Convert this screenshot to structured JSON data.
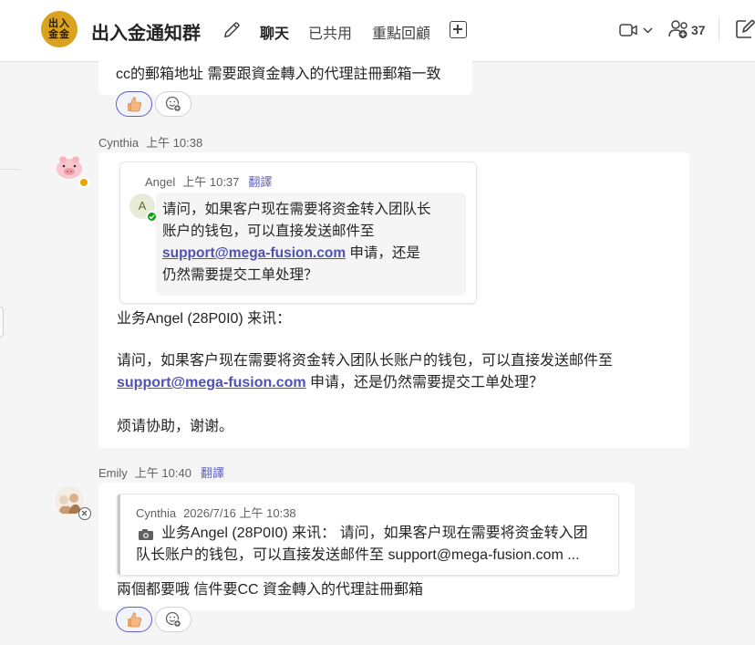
{
  "header": {
    "group_avatar_line1": "出入",
    "group_avatar_line2": "金金",
    "title": "出入金通知群",
    "tabs": [
      {
        "label": "聊天",
        "active": true
      },
      {
        "label": "已共用",
        "active": false
      },
      {
        "label": "重點回顧",
        "active": false
      }
    ],
    "participant_count": "37"
  },
  "messages": {
    "m1": {
      "text": "cc的郵箱地址 需要跟資金轉入的代理註冊郵箱一致"
    },
    "m2": {
      "sender": "Cynthia",
      "time": "上午 10:38",
      "quote": {
        "sender": "Angel",
        "time": "上午 10:37",
        "translate": "翻譯",
        "avatar_letter": "A",
        "line1": "请问，如果客户现在需要将资金转入团队长",
        "line2": "账户的钱包，可以直接发送邮件至",
        "link": "support@mega-fusion.com",
        "line3_rest": " 申请，还是",
        "line4": "仍然需要提交工单处理？"
      },
      "body_line1": "业务Angel (28P0I0) 来讯：",
      "body_line2": "请问，如果客户现在需要将资金转入团队长账户的钱包，可以直接发送邮件至",
      "body_link": "support@mega-fusion.com",
      "body_line3_rest": " 申请，还是仍然需要提交工单处理？",
      "body_line4": "烦请协助，谢谢。"
    },
    "m3": {
      "sender": "Emily",
      "time": "上午 10:40",
      "translate": "翻譯",
      "reply": {
        "sender": "Cynthia",
        "date": "2026/7/16 上午 10:38",
        "line1": "业务Angel (28P0I0) 来讯： 请问，如果客户现在需要将资金转入团",
        "line2": "队长账户的钱包，可以直接发送邮件至 support@mega-fusion.com ..."
      },
      "text": "兩個都要哦  信件要CC 資金轉入的代理註冊郵箱"
    }
  },
  "colors": {
    "accent": "#5b5fc7",
    "link": "#4f52b2",
    "available": "#13a10e",
    "away": "#eaa300"
  }
}
